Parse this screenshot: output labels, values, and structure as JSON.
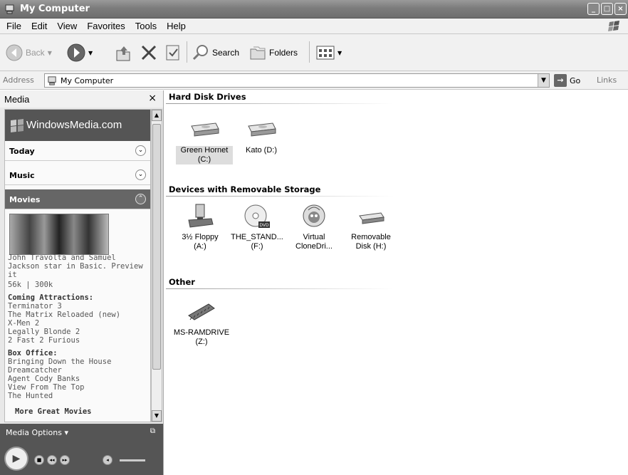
{
  "window": {
    "title": "My Computer"
  },
  "menu": [
    "File",
    "Edit",
    "View",
    "Favorites",
    "Tools",
    "Help"
  ],
  "toolbar": {
    "back_label": "Back",
    "search_label": "Search",
    "folders_label": "Folders"
  },
  "address": {
    "label": "Address",
    "value": "My Computer",
    "go_label": "Go",
    "links_label": "Links"
  },
  "media_pane": {
    "title": "Media",
    "banner": "WindowsMedia.com",
    "sections": [
      "Today",
      "Music",
      "Movies"
    ],
    "feature_text": [
      "John Travolta and Samuel",
      "Jackson star in Basic. Preview",
      "it",
      "56k | 300k"
    ],
    "coming_heading": "Coming Attractions:",
    "coming": [
      "Terminator 3",
      "The Matrix Reloaded (new)",
      "X-Men 2",
      "Legally Blonde 2",
      "2 Fast 2 Furious"
    ],
    "box_heading": "Box Office:",
    "box": [
      "Bringing Down the House",
      "Dreamcatcher",
      "Agent Cody Banks",
      "View From The Top",
      "The Hunted"
    ],
    "more_link": "More Great Movies",
    "options_label": "Media Options"
  },
  "groups": {
    "hard_disks": {
      "heading": "Hard Disk Drives",
      "items": [
        {
          "line1": "Green Hornet",
          "line2": "(C:)"
        },
        {
          "line1": "Kato (D:)",
          "line2": ""
        }
      ]
    },
    "removable": {
      "heading": "Devices with Removable Storage",
      "items": [
        {
          "line1": "3½ Floppy",
          "line2": "(A:)"
        },
        {
          "line1": "THE_STAND...",
          "line2": "(F:)"
        },
        {
          "line1": "Virtual",
          "line2": "CloneDri..."
        },
        {
          "line1": "Removable",
          "line2": "Disk (H:)"
        }
      ]
    },
    "other": {
      "heading": "Other",
      "items": [
        {
          "line1": "MS-RAMDRIVE",
          "line2": "(Z:)"
        }
      ]
    }
  }
}
